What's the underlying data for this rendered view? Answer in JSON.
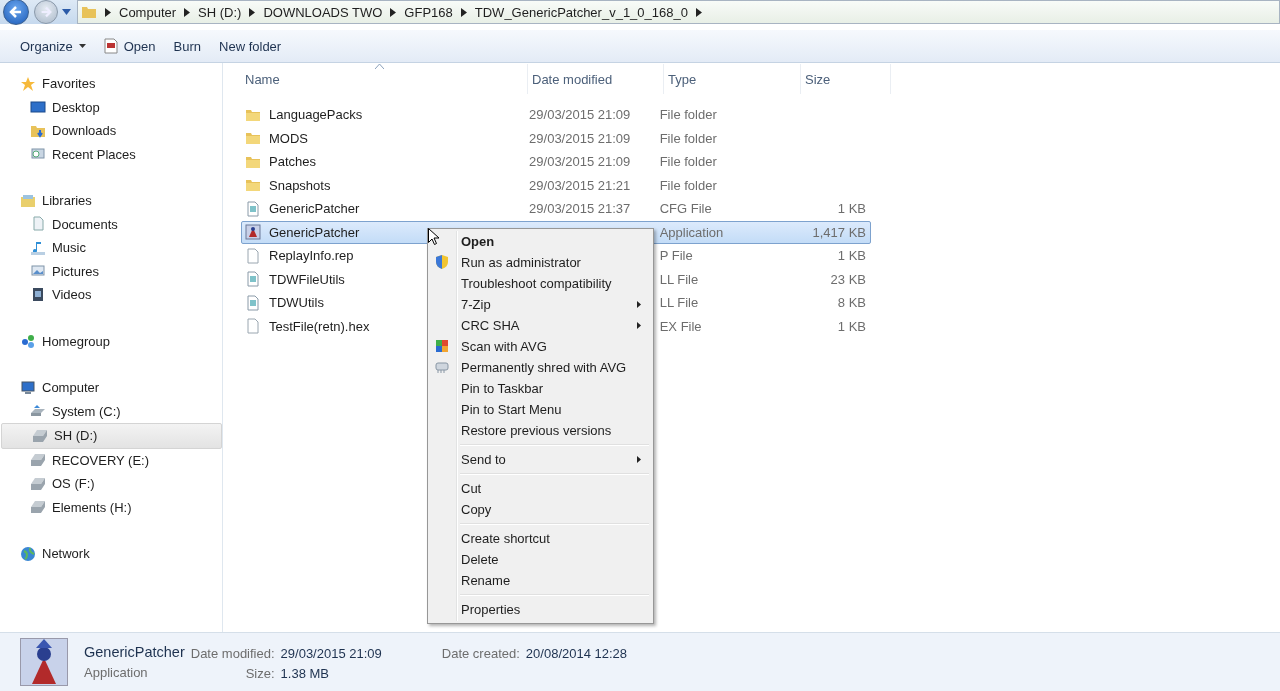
{
  "address_bar": {
    "path": [
      "Computer",
      "SH  (D:)",
      "DOWNLOADS TWO",
      "GFP168",
      "TDW_GenericPatcher_v_1_0_168_0"
    ]
  },
  "toolbar": [
    {
      "label": "Organize",
      "kind": "dropdown"
    },
    {
      "label": "Open",
      "kind": "icon"
    },
    {
      "label": "Burn",
      "kind": "plain"
    },
    {
      "label": "New folder",
      "kind": "plain"
    }
  ],
  "sidebar": {
    "groups": [
      {
        "label": "Favorites",
        "kind": "star",
        "selected": false,
        "children": [
          {
            "label": "Desktop",
            "kind": "desktop",
            "selected": false
          },
          {
            "label": "Downloads",
            "kind": "downloads",
            "selected": false
          },
          {
            "label": "Recent Places",
            "kind": "recent",
            "selected": false
          }
        ]
      },
      {
        "label": "Libraries",
        "kind": "library",
        "selected": false,
        "children": [
          {
            "label": "Documents",
            "kind": "documents",
            "selected": false
          },
          {
            "label": "Music",
            "kind": "music",
            "selected": false
          },
          {
            "label": "Pictures",
            "kind": "pictures",
            "selected": false
          },
          {
            "label": "Videos",
            "kind": "videos",
            "selected": false
          }
        ]
      },
      {
        "label": "Homegroup",
        "kind": "homegroup",
        "selected": false
      },
      {
        "label": "Computer",
        "kind": "computer",
        "selected": false,
        "children": [
          {
            "label": "System (C:)",
            "kind": "system",
            "selected": false
          },
          {
            "label": "SH  (D:)",
            "kind": "drive",
            "selected": true
          },
          {
            "label": "RECOVERY (E:)",
            "kind": "drive",
            "selected": false
          },
          {
            "label": "OS (F:)",
            "kind": "drive",
            "selected": false
          },
          {
            "label": "Elements (H:)",
            "kind": "drive",
            "selected": false
          }
        ]
      },
      {
        "label": "Network",
        "kind": "network",
        "selected": false
      }
    ]
  },
  "table": {
    "columns": [
      {
        "label": "Name",
        "sorted": true
      },
      {
        "label": "Date modified",
        "sorted": false
      },
      {
        "label": "Type",
        "sorted": false
      },
      {
        "label": "Size",
        "sorted": false
      }
    ],
    "rows": [
      {
        "name": "LanguagePacks",
        "kind": "folder",
        "date": "29/03/2015 21:09",
        "type": "File folder",
        "selected": false
      },
      {
        "name": "MODS",
        "kind": "folder",
        "date": "29/03/2015 21:09",
        "type": "File folder",
        "selected": false
      },
      {
        "name": "Patches",
        "kind": "folder",
        "date": "29/03/2015 21:09",
        "type": "File folder",
        "selected": false
      },
      {
        "name": "Snapshots",
        "kind": "folder",
        "date": "29/03/2015 21:21",
        "type": "File folder",
        "selected": false
      },
      {
        "name": "GenericPatcher",
        "kind": "config",
        "date": "29/03/2015 21:37",
        "type": "CFG File",
        "size": "1 KB",
        "selected": false
      },
      {
        "name": "GenericPatcher",
        "kind": "app",
        "type": "Application",
        "size": "1,417 KB",
        "selected": true
      },
      {
        "name": "ReplayInfo.rep",
        "kind": "blank",
        "type": "P File",
        "size": "1 KB",
        "selected": false
      },
      {
        "name": "TDWFileUtils",
        "kind": "config",
        "type": "LL File",
        "size": "23 KB",
        "selected": false
      },
      {
        "name": "TDWUtils",
        "kind": "config",
        "type": "LL File",
        "size": "8 KB",
        "selected": false
      },
      {
        "name": "TestFile(retn).hex",
        "kind": "blank",
        "type": "EX File",
        "size": "1 KB",
        "selected": false
      }
    ]
  },
  "context_menu": {
    "groups": [
      [
        {
          "label": "Open",
          "default": true
        },
        {
          "label": "Run as administrator",
          "kind": "shield"
        },
        {
          "label": "Troubleshoot compatibility"
        },
        {
          "label": "7-Zip",
          "submenu": true
        },
        {
          "label": "CRC SHA",
          "submenu": true
        },
        {
          "label": "Scan with AVG",
          "kind": "scan"
        },
        {
          "label": "Permanently shred with AVG",
          "kind": "shred"
        },
        {
          "label": "Pin to Taskbar"
        },
        {
          "label": "Pin to Start Menu"
        },
        {
          "label": "Restore previous versions"
        }
      ],
      [
        {
          "label": "Send to",
          "submenu": true
        }
      ],
      [
        {
          "label": "Cut"
        },
        {
          "label": "Copy"
        }
      ],
      [
        {
          "label": "Create shortcut"
        },
        {
          "label": "Delete"
        },
        {
          "label": "Rename"
        }
      ],
      [
        {
          "label": "Properties"
        }
      ]
    ]
  },
  "details_pane": {
    "name": "GenericPatcher",
    "type": "Application",
    "fields": [
      {
        "label": "Date modified:",
        "value": "29/03/2015 21:09"
      },
      {
        "label": "Size:",
        "value": "1.38 MB"
      },
      {
        "label": "Date created:",
        "value": "20/08/2014 12:28"
      }
    ]
  }
}
